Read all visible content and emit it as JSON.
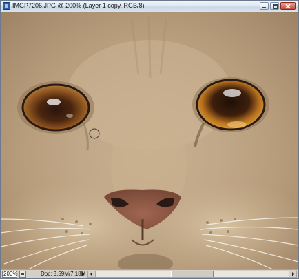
{
  "window": {
    "title": "IMGP7206.JPG @ 200% (Layer 1 copy, RGB/8)"
  },
  "canvas": {
    "content": "cat-face-photo",
    "brush_cursor": "brush-circle-icon"
  },
  "statusbar": {
    "zoom": "200%",
    "doc_info": "Doc: 3,59M/7,18M"
  },
  "colors": {
    "fur": "#c0a787",
    "iris": "#c98a2a",
    "nose": "#8f5a45",
    "titlebar": "#dfe8f2"
  }
}
